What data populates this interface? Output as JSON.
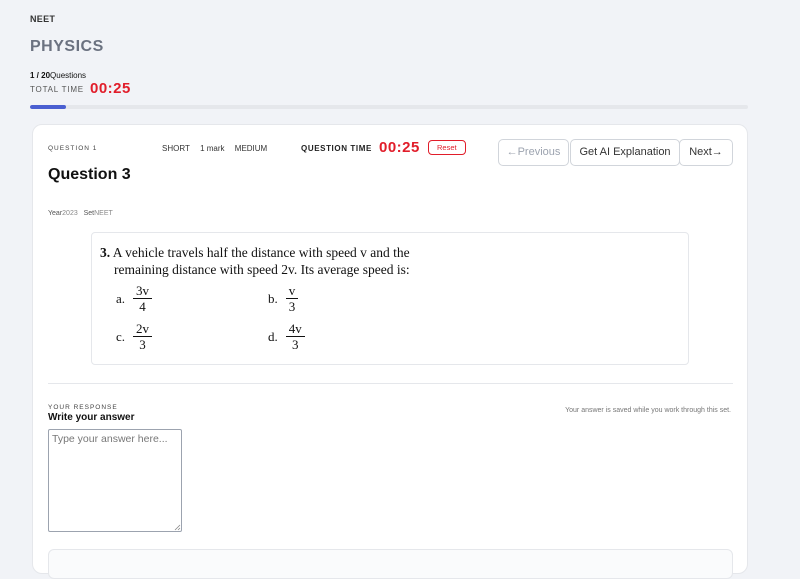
{
  "header": {
    "exam": "NEET",
    "subject": "PHYSICS",
    "count_current": "1 / 20",
    "count_suffix": "Questions",
    "total_time_label": "TOTAL TIME",
    "total_time": "00:25",
    "progress_fraction": 0.05,
    "progress_color": "#4a5fd1"
  },
  "question": {
    "index_label": "QUESTION 1",
    "type": "SHORT",
    "marks": "1 mark",
    "difficulty": "MEDIUM",
    "time_label": "QUESTION TIME",
    "time": "00:25",
    "reset_label": "Reset",
    "title": "Question 3",
    "year_label": "Year",
    "year": "2023",
    "set_label": "Set",
    "set": "NEET"
  },
  "nav": {
    "previous_label": "←Previous",
    "ai_label": "Get AI Explanation",
    "next_label": "Next→"
  },
  "question_image": {
    "number": "3.",
    "line1": "A vehicle travels half the distance with speed v and the",
    "line2": "remaining distance with speed 2v. Its average speed is:",
    "options": [
      {
        "label": "a.",
        "num": "3v",
        "den": "4"
      },
      {
        "label": "b.",
        "num": "v",
        "den": "3"
      },
      {
        "label": "c.",
        "num": "2v",
        "den": "3"
      },
      {
        "label": "d.",
        "num": "4v",
        "den": "3"
      }
    ]
  },
  "response": {
    "section_label": "YOUR RESPONSE",
    "title": "Write your answer",
    "saved_note": "Your answer is saved while you work through this set.",
    "placeholder": "Type your answer here...",
    "value": ""
  },
  "colors": {
    "accent": "#4a5fd1",
    "timer_red": "#e11d2a",
    "muted": "#6b7280"
  }
}
